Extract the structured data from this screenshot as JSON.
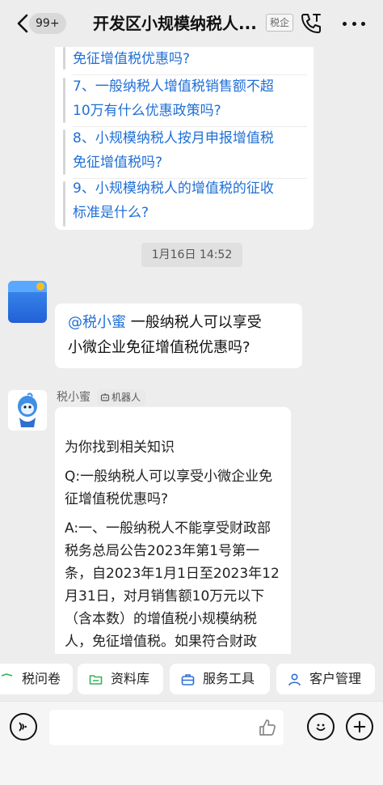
{
  "header": {
    "back_badge": "99+",
    "title": "开发区小规模纳税人...",
    "tag": "税企"
  },
  "question_list": {
    "items": [
      "免征增值税优惠吗?",
      "7、一般纳税人增值税销售额不超",
      "10万有什么优惠政策吗?",
      "8、小规模纳税人按月申报增值税",
      "免征增值税吗?",
      "9、小规模纳税人的增值税的征收",
      "标准是什么?"
    ]
  },
  "timestamp": "1月16日 14:52",
  "user_message": {
    "mention": "@税小蜜",
    "line1": " 一般纳税人可以享受",
    "line2": "小微企业免征增值税优惠吗?"
  },
  "bot": {
    "name": "税小蜜",
    "tag": "机器人",
    "reply": {
      "intro": "为你找到相关知识",
      "question": "Q:一般纳税人可以享受小微企业免征增值税优惠吗?",
      "answer": "A:一、一般纳税人不能享受财政部税务总局公告2023年第1号第一条，自2023年1月1日至2023年12月31日，对月销售额10万元以下（含本数）的增值税小规模纳税人，免征增值税。如果符合财政部、税务"
    }
  },
  "quick_actions": {
    "items": [
      "税问卷",
      "资料库",
      "服务工具",
      "客户管理"
    ]
  },
  "colors": {
    "link": "#1f6fd6",
    "background": "#ededed",
    "accent_green": "#34b35a"
  }
}
